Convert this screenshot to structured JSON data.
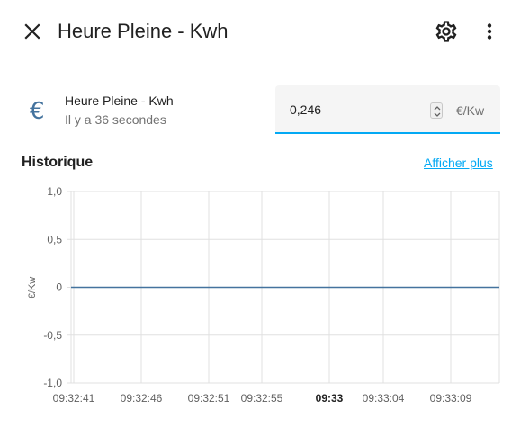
{
  "header": {
    "title": "Heure Pleine - Kwh",
    "close_icon": "close-icon",
    "settings_icon": "gear-icon",
    "more_icon": "more-vert-icon"
  },
  "entity": {
    "icon": "euro-icon",
    "icon_glyph": "€",
    "name": "Heure Pleine - Kwh",
    "last_changed": "Il y a 36 secondes",
    "value": "0,246",
    "unit": "€/Kw"
  },
  "history": {
    "title": "Historique",
    "show_more_label": "Afficher plus"
  },
  "colors": {
    "accent": "#03a9f4",
    "icon": "#44739e",
    "series": "#44739e"
  },
  "chart_data": {
    "type": "line",
    "ylabel": "€/Kw",
    "ylim": [
      -1.0,
      1.0
    ],
    "y_ticks": [
      "1,0",
      "0,5",
      "0",
      "-0,5",
      "-1,0"
    ],
    "x_ticks": [
      "09:32:41",
      "09:32:46",
      "09:32:51",
      "09:32:55",
      "09:33",
      "09:33:04",
      "09:33:09"
    ],
    "x_tick_bold": [
      false,
      false,
      false,
      false,
      true,
      false,
      false
    ],
    "series": [
      {
        "values": [
          0,
          0,
          0,
          0,
          0,
          0,
          0
        ]
      }
    ],
    "grid": true
  }
}
